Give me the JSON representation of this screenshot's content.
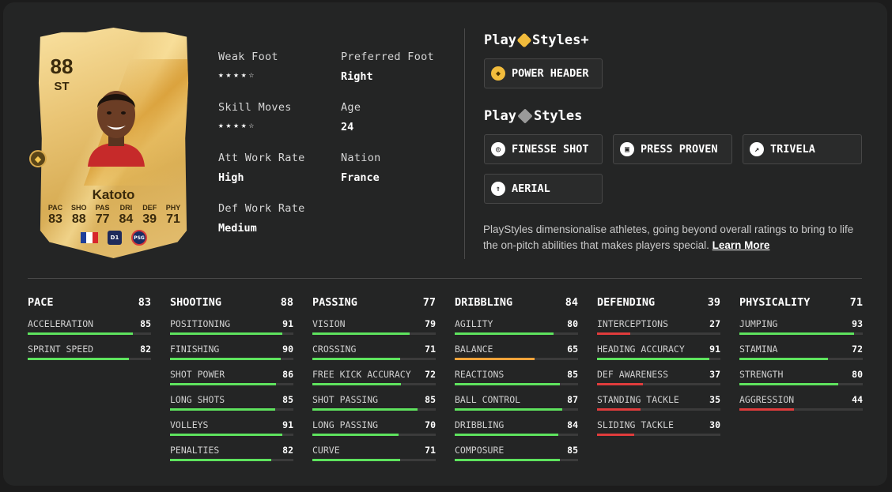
{
  "card": {
    "rating": "88",
    "position": "ST",
    "name": "Katoto",
    "stats": [
      {
        "label": "PAC",
        "value": "83"
      },
      {
        "label": "SHO",
        "value": "88"
      },
      {
        "label": "PAS",
        "value": "77"
      },
      {
        "label": "DRI",
        "value": "84"
      },
      {
        "label": "DEF",
        "value": "39"
      },
      {
        "label": "PHY",
        "value": "71"
      }
    ],
    "league_badge": "D1",
    "club_badge": "PSG"
  },
  "info": {
    "weak_foot_label": "Weak Foot",
    "weak_foot_stars": "★★★★☆",
    "preferred_foot_label": "Preferred Foot",
    "preferred_foot_value": "Right",
    "skill_moves_label": "Skill Moves",
    "skill_moves_stars": "★★★★☆",
    "age_label": "Age",
    "age_value": "24",
    "att_work_rate_label": "Att Work Rate",
    "att_work_rate_value": "High",
    "nation_label": "Nation",
    "nation_value": "France",
    "def_work_rate_label": "Def Work Rate",
    "def_work_rate_value": "Medium"
  },
  "playstyles_plus": {
    "title_a": "Play",
    "title_b": "Styles+",
    "items": [
      "POWER HEADER"
    ]
  },
  "playstyles": {
    "title_a": "Play",
    "title_b": "Styles",
    "items": [
      "FINESSE SHOT",
      "PRESS PROVEN",
      "TRIVELA",
      "AERIAL"
    ]
  },
  "description": {
    "text": "PlayStyles dimensionalise athletes, going beyond overall ratings to bring to life the on-pitch abilities that makes players special. ",
    "link": "Learn More"
  },
  "colors": {
    "high": "#5ee35e",
    "mid": "#f0a33a",
    "low": "#e03c3c"
  },
  "attributes": [
    {
      "name": "PACE",
      "value": "83",
      "items": [
        {
          "label": "ACCELERATION",
          "value": 85
        },
        {
          "label": "SPRINT SPEED",
          "value": 82
        }
      ]
    },
    {
      "name": "SHOOTING",
      "value": "88",
      "items": [
        {
          "label": "POSITIONING",
          "value": 91
        },
        {
          "label": "FINISHING",
          "value": 90
        },
        {
          "label": "SHOT POWER",
          "value": 86
        },
        {
          "label": "LONG SHOTS",
          "value": 85
        },
        {
          "label": "VOLLEYS",
          "value": 91
        },
        {
          "label": "PENALTIES",
          "value": 82
        }
      ]
    },
    {
      "name": "PASSING",
      "value": "77",
      "items": [
        {
          "label": "VISION",
          "value": 79
        },
        {
          "label": "CROSSING",
          "value": 71
        },
        {
          "label": "FREE KICK ACCURACY",
          "value": 72
        },
        {
          "label": "SHOT PASSING",
          "value": 85
        },
        {
          "label": "LONG PASSING",
          "value": 70
        },
        {
          "label": "CURVE",
          "value": 71
        }
      ]
    },
    {
      "name": "DRIBBLING",
      "value": "84",
      "items": [
        {
          "label": "AGILITY",
          "value": 80
        },
        {
          "label": "BALANCE",
          "value": 65
        },
        {
          "label": "REACTIONS",
          "value": 85
        },
        {
          "label": "BALL CONTROL",
          "value": 87
        },
        {
          "label": "DRIBBLING",
          "value": 84
        },
        {
          "label": "COMPOSURE",
          "value": 85
        }
      ]
    },
    {
      "name": "DEFENDING",
      "value": "39",
      "items": [
        {
          "label": "INTERCEPTIONS",
          "value": 27
        },
        {
          "label": "HEADING ACCURACY",
          "value": 91
        },
        {
          "label": "DEF AWARENESS",
          "value": 37
        },
        {
          "label": "STANDING TACKLE",
          "value": 35
        },
        {
          "label": "SLIDING TACKLE",
          "value": 30
        }
      ]
    },
    {
      "name": "PHYSICALITY",
      "value": "71",
      "items": [
        {
          "label": "JUMPING",
          "value": 93
        },
        {
          "label": "STAMINA",
          "value": 72
        },
        {
          "label": "STRENGTH",
          "value": 80
        },
        {
          "label": "AGGRESSION",
          "value": 44
        }
      ]
    }
  ]
}
